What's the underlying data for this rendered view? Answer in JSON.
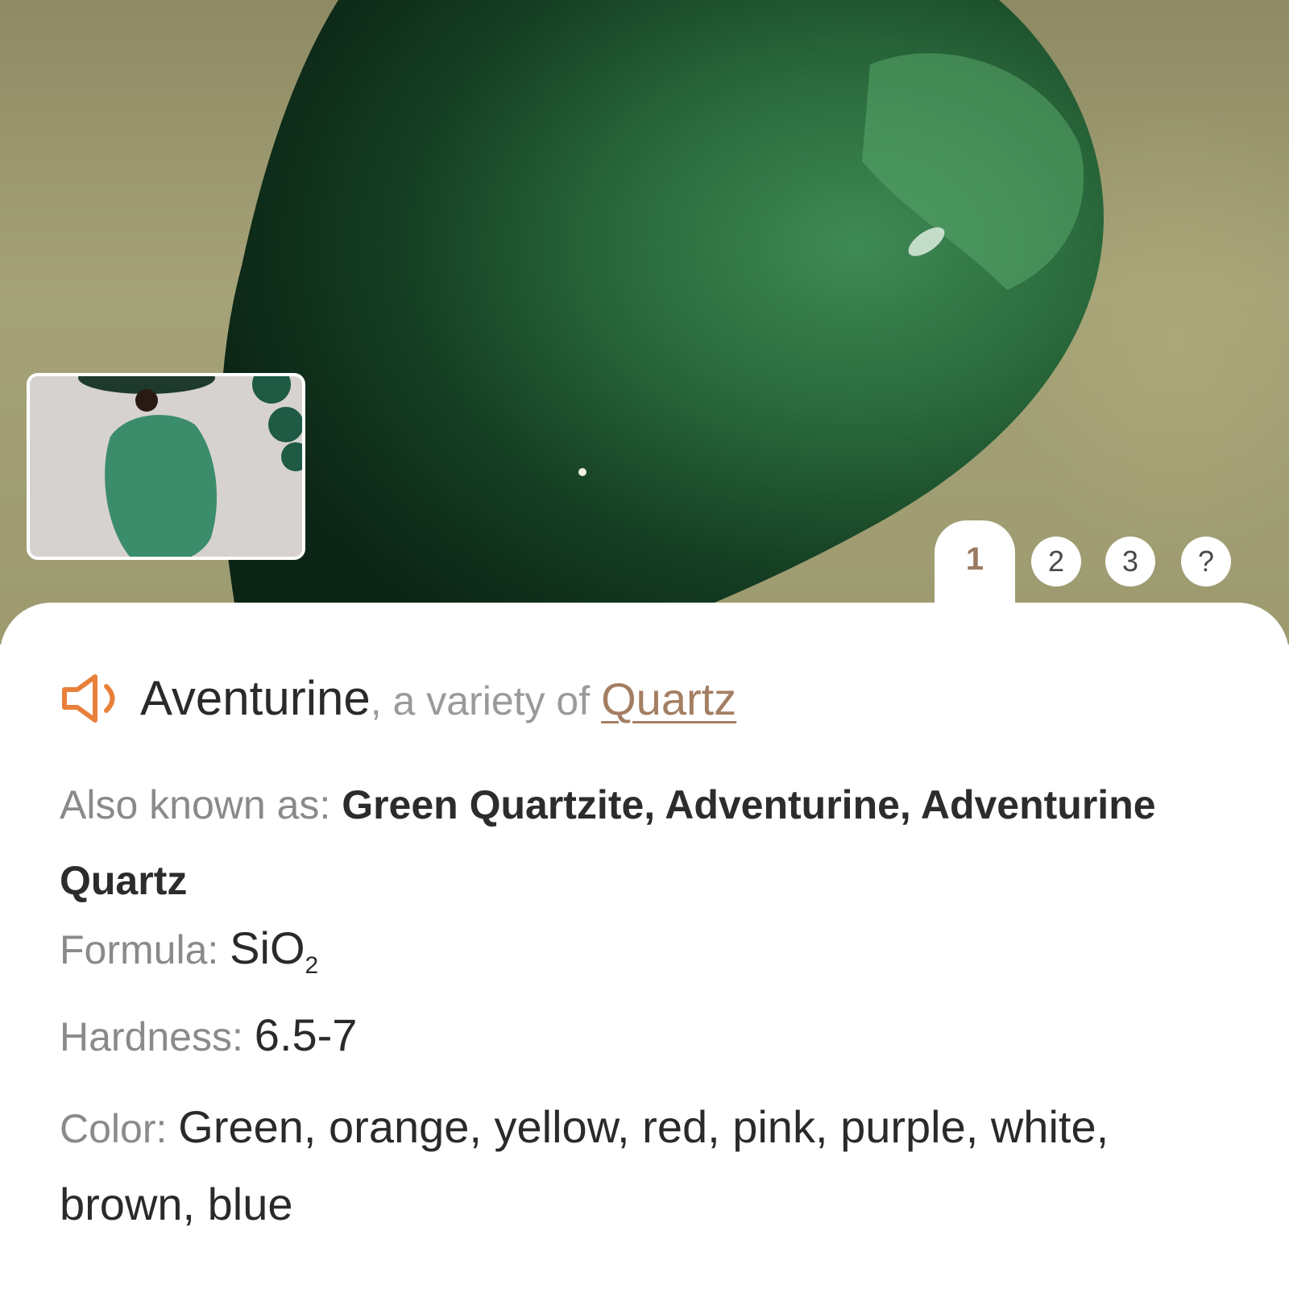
{
  "tabs": [
    "1",
    "2",
    "3",
    "?"
  ],
  "mineral": {
    "name": "Aventurine",
    "variety_text": ", a variety of",
    "parent": "Quartz"
  },
  "properties": {
    "aka_label": "Also known as:",
    "aka_value": "Green Quartzite, Adventurine, Adventurine Quartz",
    "formula_label": "Formula:",
    "formula_main": "SiO",
    "formula_sub": "2",
    "hardness_label": "Hardness:",
    "hardness_value": "6.5-7",
    "color_label": "Color:",
    "color_value": "Green, orange, yellow, red, pink, purple, white, brown, blue"
  },
  "icons": {
    "speaker": "speaker-icon"
  },
  "colors": {
    "accent": "#e8803a",
    "link": "#a47e62",
    "label": "#8a8a8a",
    "text": "#2a2a2a"
  }
}
